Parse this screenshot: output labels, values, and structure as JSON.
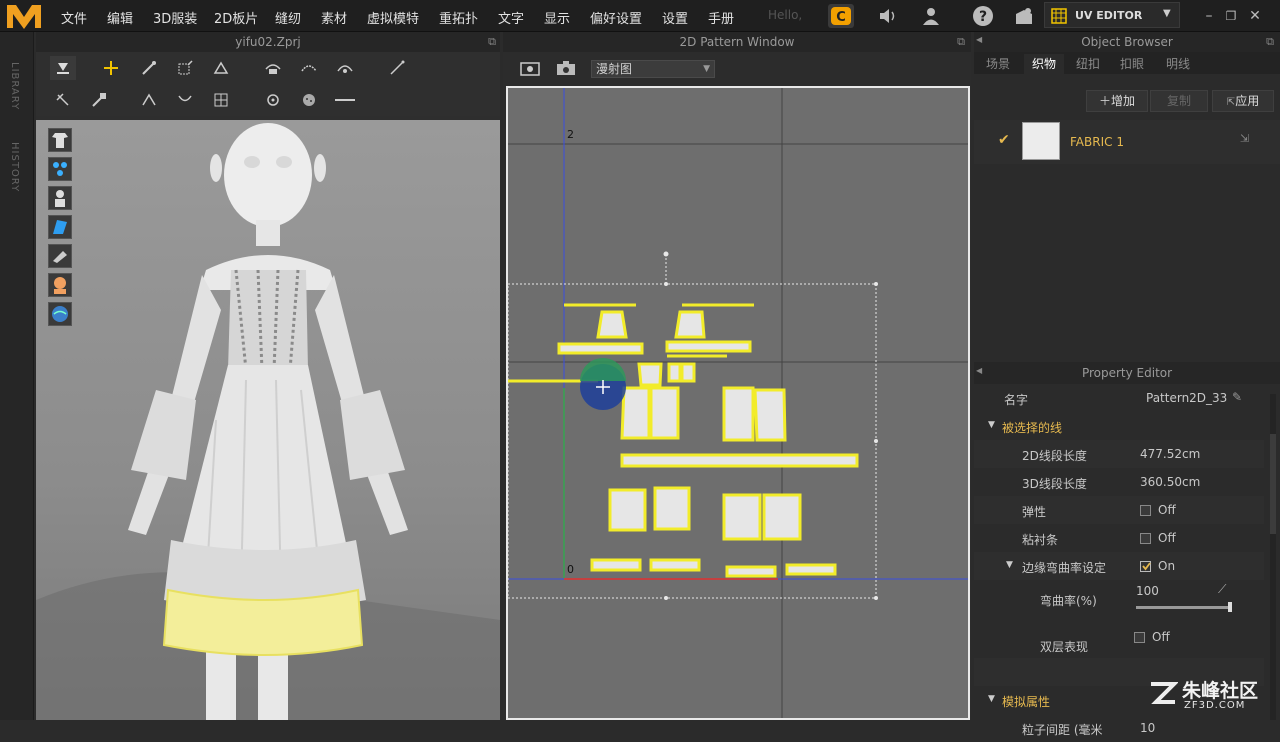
{
  "menubar": {
    "items": [
      "文件",
      "编辑",
      "3D服装",
      "2D板片",
      "缝纫",
      "素材",
      "虚拟模特",
      "重拓扑",
      "文字",
      "显示",
      "偏好设置",
      "设置",
      "手册"
    ],
    "hello": "Hello,",
    "uv_editor": "UV EDITOR"
  },
  "left_strip": {
    "library": "LIBRARY",
    "history": "HISTORY"
  },
  "panel3d": {
    "title": "yifu02.Zprj"
  },
  "panel2d": {
    "title": "2D Pattern Window",
    "view_mode": "漫射图",
    "axis_top_label": "2",
    "axis_origin_label": "0"
  },
  "object_browser": {
    "title": "Object Browser",
    "tabs": [
      "场景",
      "织物",
      "纽扣",
      "扣眼",
      "明线"
    ],
    "active_tab": "织物",
    "add_label": "增加",
    "copy_label": "复制",
    "apply_label": "应用",
    "fabric_name": "FABRIC 1"
  },
  "property_editor": {
    "title": "Property Editor",
    "name_label": "名字",
    "name_value": "Pattern2D_33",
    "section_selected_line": "被选择的线",
    "line_2d_label": "2D线段长度",
    "line_2d_value": "477.52cm",
    "line_3d_label": "3D线段长度",
    "line_3d_value": "360.50cm",
    "elastic_label": "弹性",
    "elastic_value": "Off",
    "fusible_label": "粘衬条",
    "fusible_value": "Off",
    "curvature_setting_label": "边缘弯曲率设定",
    "curvature_setting_value": "On",
    "curvature_label": "弯曲率(%)",
    "curvature_value": "100",
    "curvature_level": 1.0,
    "double_label": "双层表现",
    "double_value": "Off",
    "section_sim": "模拟属性",
    "particle_label": "粒子间距 (毫米",
    "particle_value": "10"
  },
  "watermark": {
    "main": "朱峰社区",
    "sub": "ZF3D.COM"
  },
  "colors": {
    "accent": "#e6b94f",
    "pattern_outline": "#f2ec2a",
    "uv_active": "#f2c400",
    "logo": "#f0a020"
  }
}
